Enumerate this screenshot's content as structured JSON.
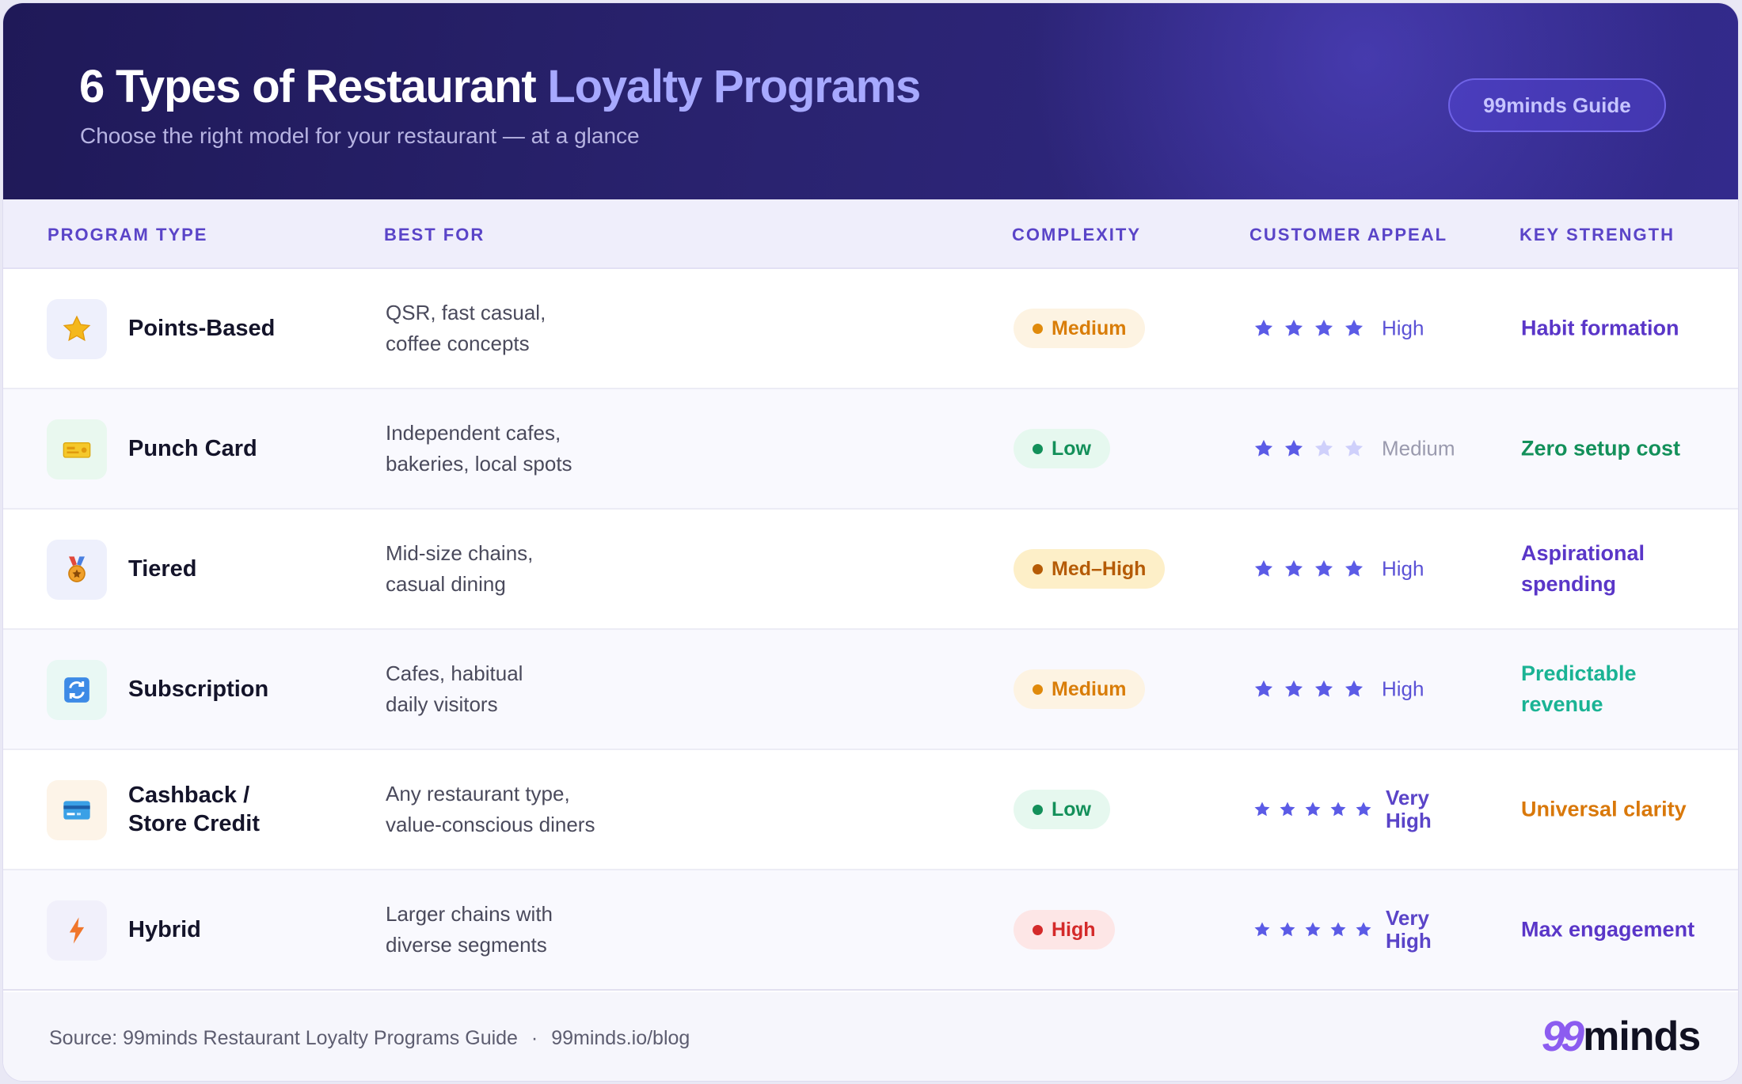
{
  "header": {
    "title_main": "6 Types of Restaurant",
    "title_accent": "Loyalty Programs",
    "subtitle": "Choose the right model for your restaurant — at a glance",
    "guide_badge": "99minds Guide"
  },
  "columns": {
    "program_type": "PROGRAM TYPE",
    "best_for": "BEST FOR",
    "complexity": "COMPLEXITY",
    "customer_appeal": "CUSTOMER APPEAL",
    "key_strength": "KEY STRENGTH"
  },
  "rows": [
    {
      "icon": "star-icon",
      "name": "Points-Based",
      "best_for_line1": "QSR, fast casual,",
      "best_for_line2": "coffee concepts",
      "complexity": "Medium",
      "stars_filled": 4,
      "stars_total": 4,
      "appeal_line1": "High",
      "appeal_line2": "",
      "strength_line1": "Habit formation",
      "strength_line2": "",
      "strength_color": "#5a36c8"
    },
    {
      "icon": "ticket-icon",
      "name": "Punch Card",
      "best_for_line1": "Independent cafes,",
      "best_for_line2": "bakeries, local spots",
      "complexity": "Low",
      "stars_filled": 2,
      "stars_total": 4,
      "appeal_line1": "Medium",
      "appeal_line2": "",
      "strength_line1": "Zero setup cost",
      "strength_line2": "",
      "strength_color": "#13905a"
    },
    {
      "icon": "medal-icon",
      "name": "Tiered",
      "best_for_line1": "Mid-size chains,",
      "best_for_line2": "casual dining",
      "complexity": "Med–High",
      "stars_filled": 4,
      "stars_total": 4,
      "appeal_line1": "High",
      "appeal_line2": "",
      "strength_line1": "Aspirational",
      "strength_line2": "spending",
      "strength_color": "#5a36c8"
    },
    {
      "icon": "refresh-icon",
      "name": "Subscription",
      "best_for_line1": "Cafes, habitual",
      "best_for_line2": "daily visitors",
      "complexity": "Medium",
      "stars_filled": 4,
      "stars_total": 4,
      "appeal_line1": "High",
      "appeal_line2": "",
      "strength_line1": "Predictable",
      "strength_line2": "revenue",
      "strength_color": "#1ab394"
    },
    {
      "icon": "credit-card-icon",
      "name_line1": "Cashback /",
      "name_line2": "Store Credit",
      "best_for_line1": "Any restaurant type,",
      "best_for_line2": "value-conscious diners",
      "complexity": "Low",
      "stars_filled": 5,
      "stars_total": 5,
      "appeal_line1": "Very",
      "appeal_line2": "High",
      "strength_line1": "Universal clarity",
      "strength_line2": "",
      "strength_color": "#d9780a"
    },
    {
      "icon": "lightning-icon",
      "name": "Hybrid",
      "best_for_line1": "Larger chains with",
      "best_for_line2": "diverse segments",
      "complexity": "High",
      "stars_filled": 5,
      "stars_total": 5,
      "appeal_line1": "Very",
      "appeal_line2": "High",
      "strength_line1": "Max engagement",
      "strength_line2": "",
      "strength_color": "#5a36c8"
    }
  ],
  "footer": {
    "source": "Source: 99minds Restaurant Loyalty Programs Guide",
    "separator": "·",
    "url": "99minds.io/blog",
    "logo_mark": "99",
    "logo_word": "minds"
  },
  "colors": {
    "header_bg": "#2a2370",
    "accent": "#a7a9ff",
    "column_header": "#5a44c8",
    "star_filled": "#5b5be6",
    "star_empty": "#cfd0fb"
  }
}
